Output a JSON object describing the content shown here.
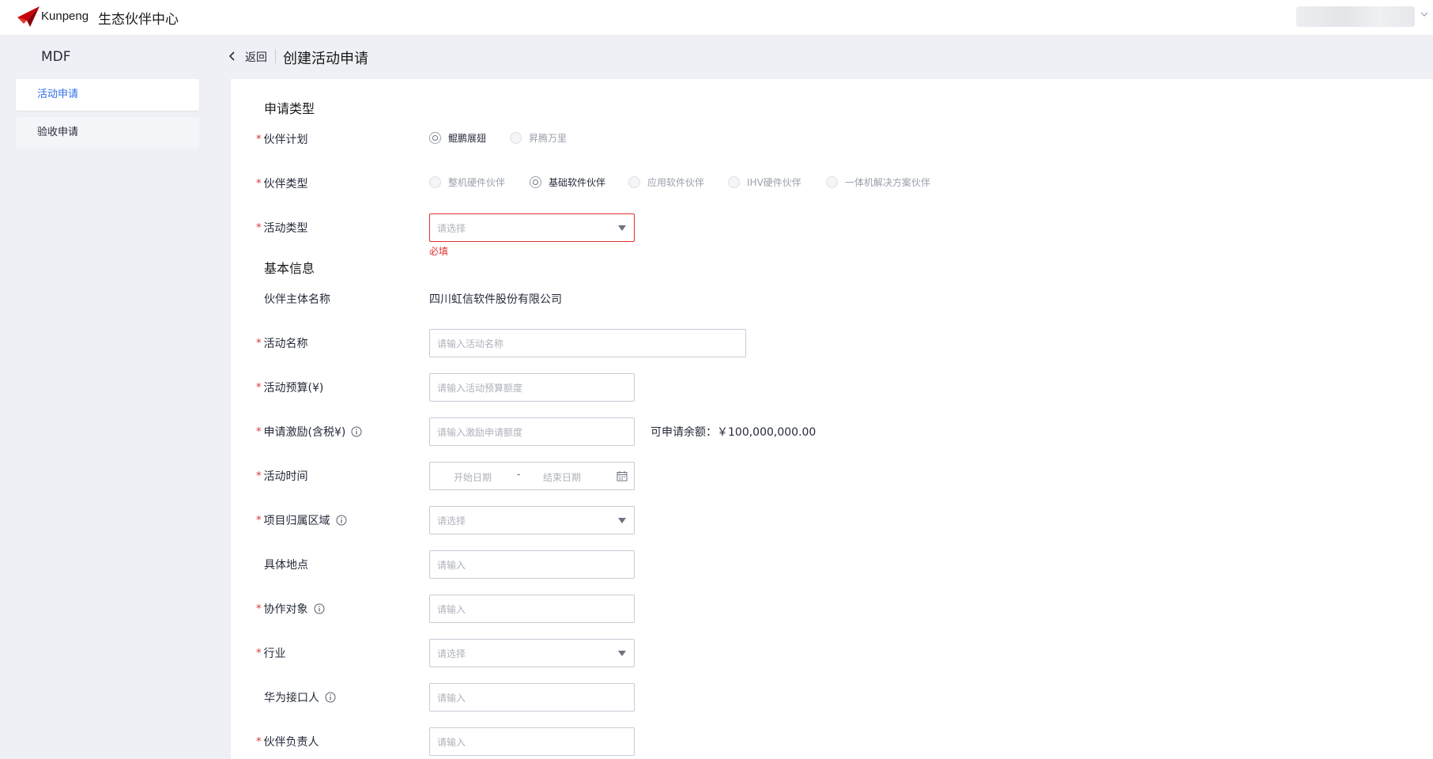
{
  "header": {
    "brand": "Kunpeng",
    "portal_title": "生态伙伴中心"
  },
  "sidebar": {
    "title": "MDF",
    "items": [
      {
        "label": "活动申请",
        "active": true
      },
      {
        "label": "验收申请",
        "active": false
      }
    ]
  },
  "page": {
    "back_label": "返回",
    "title": "创建活动申请"
  },
  "form": {
    "section_apply_type": "申请类型",
    "partner_plan": {
      "label": "伙伴计划",
      "options": [
        "鲲鹏展翅",
        "昇腾万里"
      ],
      "selected": "鲲鹏展翅"
    },
    "partner_type": {
      "label": "伙伴类型",
      "options": [
        "整机硬件伙伴",
        "基础软件伙伴",
        "应用软件伙伴",
        "IHV硬件伙伴",
        "一体机解决方案伙伴"
      ],
      "selected": "基础软件伙伴"
    },
    "activity_type": {
      "label": "活动类型",
      "placeholder": "请选择",
      "error": "必填"
    },
    "section_basic": "基本信息",
    "partner_name": {
      "label": "伙伴主体名称",
      "value": "四川虹信软件股份有限公司"
    },
    "activity_name": {
      "label": "活动名称",
      "placeholder": "请输入活动名称"
    },
    "activity_budget": {
      "label": "活动预算(¥)",
      "placeholder": "请输入活动预算额度"
    },
    "incentive": {
      "label": "申请激励(含税¥)",
      "placeholder": "请输入激励申请额度",
      "available_text": "可申请余额：￥100,000,000.00"
    },
    "activity_time": {
      "label": "活动时间",
      "start_placeholder": "开始日期",
      "separator": "-",
      "end_placeholder": "结束日期"
    },
    "region": {
      "label": "项目归属区域",
      "placeholder": "请选择"
    },
    "location": {
      "label": "具体地点",
      "placeholder": "请输入"
    },
    "collab_target": {
      "label": "协作对象",
      "placeholder": "请输入"
    },
    "industry": {
      "label": "行业",
      "placeholder": "请选择"
    },
    "huawei_contact": {
      "label": "华为接口人",
      "placeholder": "请输入"
    },
    "partner_owner": {
      "label": "伙伴负责人",
      "placeholder": "请输入"
    }
  },
  "colors": {
    "accent": "#2c6fe8",
    "error": "#e02f2f",
    "background": "#eef0f5",
    "logo_red": "#c7000b"
  }
}
